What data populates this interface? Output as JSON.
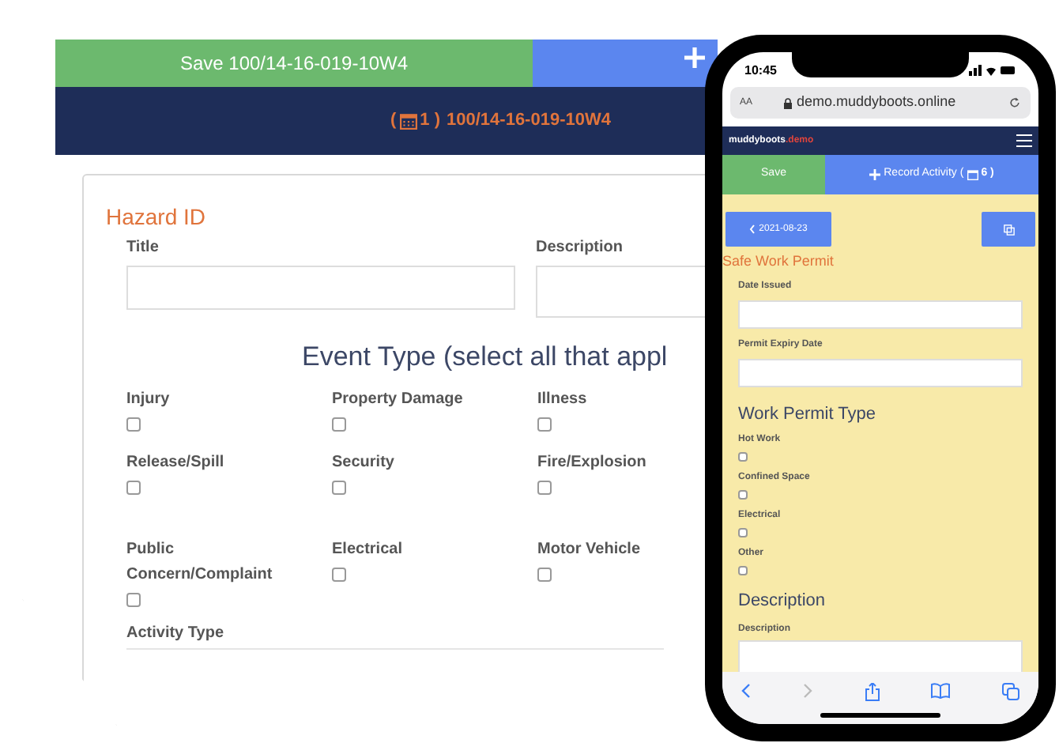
{
  "desktop": {
    "save_button": "Save 100/14-16-019-10W4",
    "record_header": {
      "open": "(",
      "count": "1 )",
      "title": "100/14-16-019-10W4"
    },
    "section_title": "Hazard ID",
    "fields": [
      {
        "label": "Title"
      },
      {
        "label": "Description"
      }
    ],
    "event_type_heading": "Event Type (select all that appl",
    "event_types": [
      {
        "label": "Injury",
        "checked": false
      },
      {
        "label": "Property Damage",
        "checked": false
      },
      {
        "label": "Illness",
        "checked": false
      },
      {
        "label": "Release/Spill",
        "checked": false
      },
      {
        "label": "Security",
        "checked": false
      },
      {
        "label": "Fire/Explosion",
        "checked": false
      },
      {
        "label": "Public Concern/Complaint",
        "checked": false
      },
      {
        "label": "Electrical",
        "checked": false
      },
      {
        "label": "Motor Vehicle",
        "checked": false
      }
    ],
    "activity_type_label": "Activity Type"
  },
  "phone": {
    "time": "10:45",
    "text_size": "AA",
    "url": "demo.muddyboots.online",
    "brand": {
      "name": "muddyboots",
      "suffix": ".demo"
    },
    "save_button": "Save",
    "record_button": {
      "label": "Record Activity (",
      "count": "6 )"
    },
    "back_button": "2021-08-23",
    "form_title": "Safe Work Permit",
    "fields": [
      {
        "label": "Date Issued"
      },
      {
        "label": "Permit Expiry Date"
      }
    ],
    "permit_type_heading": "Work Permit Type",
    "permit_types": [
      {
        "label": "Hot Work",
        "checked": false
      },
      {
        "label": "Confined Space",
        "checked": false
      },
      {
        "label": "Electrical",
        "checked": false
      },
      {
        "label": "Other",
        "checked": false
      }
    ],
    "description_heading": "Description",
    "description_label": "Description"
  }
}
